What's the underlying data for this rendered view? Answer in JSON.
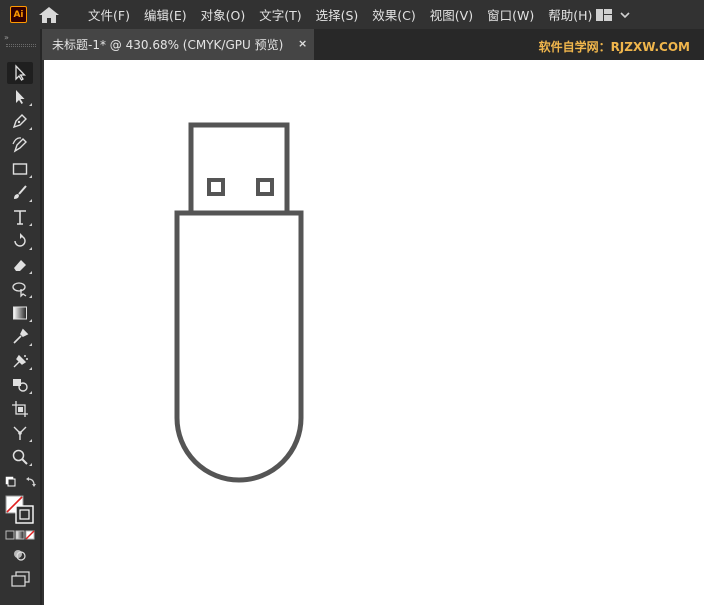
{
  "app": {
    "logo_text": "Ai",
    "logo_color": "#ff9a00"
  },
  "menu": {
    "items": [
      {
        "label": "文件(F)"
      },
      {
        "label": "编辑(E)"
      },
      {
        "label": "对象(O)"
      },
      {
        "label": "文字(T)"
      },
      {
        "label": "选择(S)"
      },
      {
        "label": "效果(C)"
      },
      {
        "label": "视图(V)"
      },
      {
        "label": "窗口(W)"
      },
      {
        "label": "帮助(H)"
      }
    ]
  },
  "document_tab": {
    "title": "未标题-1* @ 430.68% (CMYK/GPU 预览)",
    "close_glyph": "×"
  },
  "watermark": {
    "text": "软件自学网：RJZXW.COM",
    "color": "#f0b64c"
  },
  "toolbar": {
    "grip_glyph": "»",
    "tools": [
      {
        "name": "selection-tool",
        "icon": "selection-arrow-icon"
      },
      {
        "name": "direct-selection-tool",
        "icon": "direct-selection-icon"
      },
      {
        "name": "pen-tool",
        "icon": "pen-icon"
      },
      {
        "name": "curvature-tool",
        "icon": "curvature-icon"
      },
      {
        "name": "rectangle-tool",
        "icon": "rectangle-icon"
      },
      {
        "name": "paintbrush-tool",
        "icon": "paintbrush-icon"
      },
      {
        "name": "type-tool",
        "icon": "type-icon"
      },
      {
        "name": "rotate-tool",
        "icon": "rotate-icon"
      },
      {
        "name": "eraser-tool",
        "icon": "eraser-icon"
      },
      {
        "name": "lasso-tool",
        "icon": "lasso-icon"
      },
      {
        "name": "gradient-tool",
        "icon": "gradient-icon"
      },
      {
        "name": "eyedropper-tool",
        "icon": "eyedropper-icon"
      },
      {
        "name": "symbol-sprayer-tool",
        "icon": "symbol-sprayer-icon"
      },
      {
        "name": "shape-builder-tool",
        "icon": "shape-builder-icon"
      },
      {
        "name": "artboard-tool",
        "icon": "artboard-icon"
      },
      {
        "name": "puppet-warp-tool",
        "icon": "puppet-warp-icon"
      },
      {
        "name": "zoom-tool",
        "icon": "zoom-icon"
      }
    ]
  },
  "canvas": {
    "background": "#ffffff",
    "stroke_color": "#555555"
  }
}
